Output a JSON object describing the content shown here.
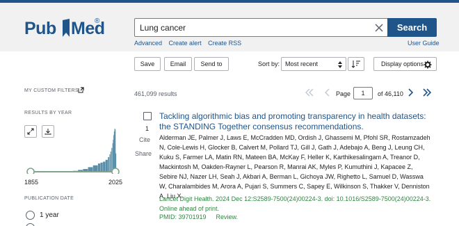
{
  "header": {
    "logo_left": "Pub",
    "logo_right": "Med",
    "logo_reg": "®",
    "search_value": "Lung cancer",
    "search_button": "Search",
    "links": [
      "Advanced",
      "Create alert",
      "Create RSS"
    ],
    "user_guide": "User Guide"
  },
  "toolbar": {
    "save": "Save",
    "email": "Email",
    "send_to": "Send to",
    "sort_by_label": "Sort by:",
    "sort_value": "Most recent",
    "display_options": "Display options"
  },
  "sidebar": {
    "my_custom_filters": "MY CUSTOM FILTERS",
    "results_by_year": "RESULTS BY YEAR",
    "year_start": "1855",
    "year_end": "2025",
    "publication_date": "PUBLICATION DATE",
    "date_options": [
      "1 year"
    ]
  },
  "results": {
    "count": "461,099 results",
    "page_label": "Page",
    "page_value": "1",
    "page_of": "of 46,110",
    "items": [
      {
        "number": "1",
        "cite": "Cite",
        "share": "Share",
        "title": "Tackling algorithmic bias and promoting transparency in health datasets: the STANDING Together consensus recommendations.",
        "authors": "Alderman JE, Palmer J, Laws E, McCradden MD, Ordish J, Ghassemi M, Pfohl SR, Rostamzadeh N, Cole-Lewis H, Glocker B, Calvert M, Pollard TJ, Gill J, Gath J, Adebajo A, Beng J, Leung CH, Kuku S, Farmer LA, Matin RN, Mateen BA, McKay F, Heller K, Karthikesalingam A, Treanor D, Mackintosh M, Oakden-Rayner L, Pearson R, Manrai AK, Myles P, Kumuthini J, Kapacee Z, Sebire NJ, Nazer LH, Seah J, Akbari A, Berman L, Gichoya JW, Righetto L, Samuel D, Wasswa W, Charalambides M, Arora A, Pujari S, Summers C, Sapey E, Wilkinson S, Thakker V, Denniston A, Liu X.",
        "citation": "Lancet Digit Health. 2024 Dec 12:S2589-7500(24)00224-3. doi: 10.1016/S2589-7500(24)00224-3. Online ahead of print.",
        "pmid": "PMID: 39701919",
        "pub_type": "Review."
      }
    ]
  },
  "chart_data": {
    "type": "area",
    "x": [
      1855,
      1880,
      1900,
      1920,
      1940,
      1950,
      1960,
      1970,
      1980,
      1990,
      1995,
      2000,
      2005,
      2010,
      2013,
      2015,
      2017,
      2019,
      2020,
      2021,
      2022,
      2023,
      2024,
      2025
    ],
    "values": [
      0,
      0,
      0,
      0.5,
      1,
      2,
      3,
      5,
      7,
      9,
      10,
      11,
      13,
      16,
      19,
      22,
      26,
      31,
      35,
      40,
      44,
      47,
      46,
      20
    ],
    "xlim": [
      1855,
      2025
    ],
    "colors": {
      "fill": "#5b8fa8",
      "range_line": "#7fa38d"
    }
  },
  "colors": {
    "brand": "#20558a",
    "citation_green": "#2e8540",
    "header_bg": "#f1f1f1"
  },
  "icons": {
    "clear": "close-icon",
    "sort_order": "sort-order-icon",
    "display": "gear-icon",
    "external": "external-link-icon",
    "expand": "expand-icon",
    "download": "download-icon"
  }
}
